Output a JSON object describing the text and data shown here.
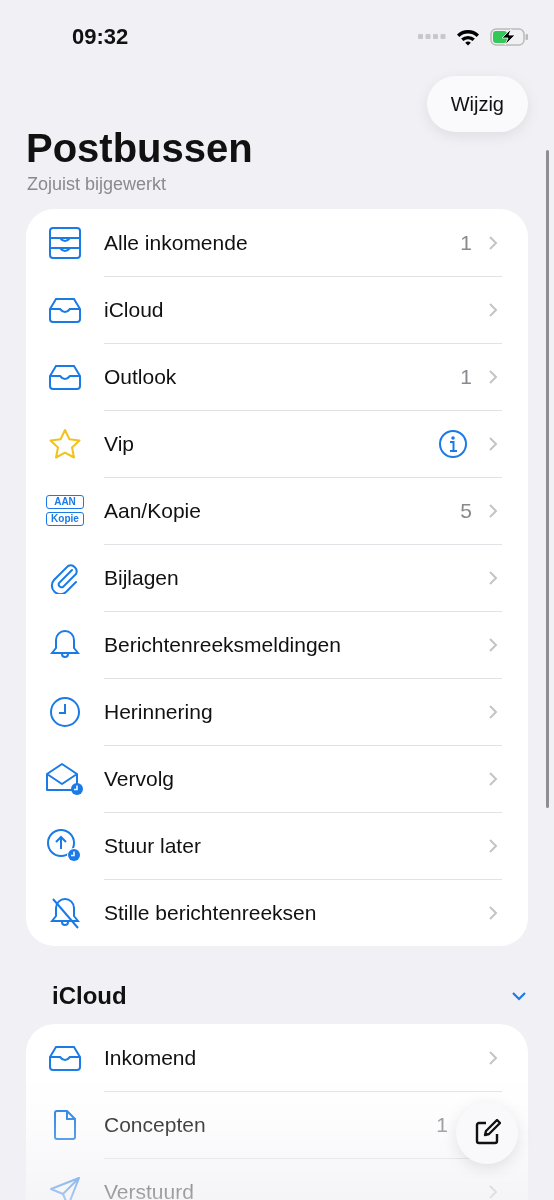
{
  "status_bar": {
    "time": "09:32"
  },
  "edit_button": {
    "label": "Wijzig"
  },
  "title": "Postbussen",
  "subtitle": "Zojuist bijgewerkt",
  "mailboxes": [
    {
      "kind": "all-inboxes",
      "label": "Alle inkomende",
      "count": "1"
    },
    {
      "kind": "inbox",
      "label": "iCloud"
    },
    {
      "kind": "inbox",
      "label": "Outlook",
      "count": "1"
    },
    {
      "kind": "vip",
      "label": "Vip",
      "info": true
    },
    {
      "kind": "to-cc",
      "label": "Aan/Kopie",
      "count": "5",
      "icon_labels": [
        "AAN",
        "Kopie"
      ]
    },
    {
      "kind": "attachment",
      "label": "Bijlagen"
    },
    {
      "kind": "bell",
      "label": "Berichtenreeksmeldingen"
    },
    {
      "kind": "clock",
      "label": "Herinnering"
    },
    {
      "kind": "follow-up",
      "label": "Vervolg"
    },
    {
      "kind": "send-later",
      "label": "Stuur later"
    },
    {
      "kind": "muted",
      "label": "Stille berichtenreeksen"
    }
  ],
  "section": {
    "title": "iCloud",
    "expanded": true,
    "items": [
      {
        "kind": "inbox",
        "label": "Inkomend"
      },
      {
        "kind": "draft",
        "label": "Concepten",
        "count": "1"
      },
      {
        "kind": "sent",
        "label": "Verstuurd"
      }
    ]
  }
}
